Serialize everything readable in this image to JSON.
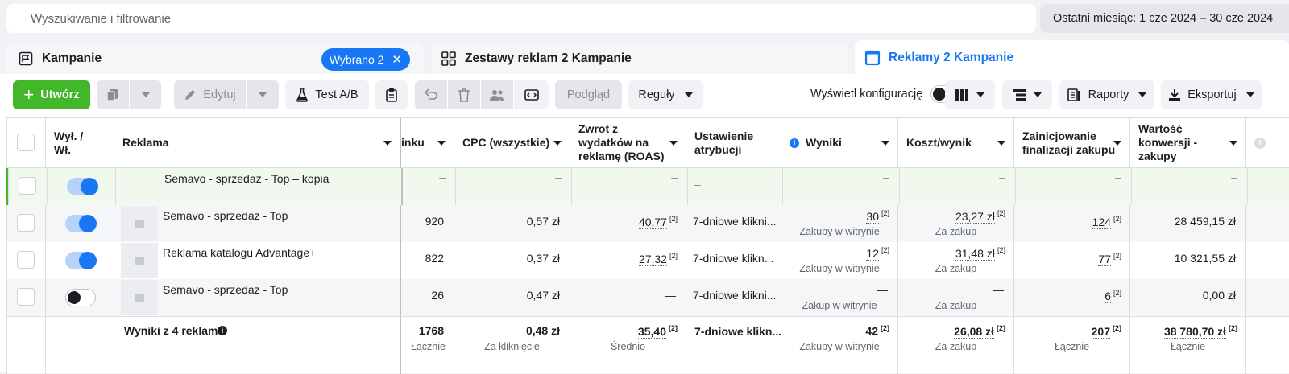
{
  "search": {
    "placeholder": "Wyszukiwanie i filtrowanie"
  },
  "date_range": "Ostatni miesiąc: 1 cze 2024 – 30 cze 2024",
  "tabs": {
    "campaigns": "Kampanie",
    "selected_badge": "Wybrano 2",
    "adsets": "Zestawy reklam 2 Kampanie",
    "ads": "Reklamy 2 Kampanie"
  },
  "toolbar": {
    "create": "Utwórz",
    "edit": "Edytuj",
    "abtest": "Test A/B",
    "preview": "Podgląd",
    "rules": "Reguły",
    "show_config": "Wyświetl konfigurację",
    "reports": "Raporty",
    "export": "Eksportuj"
  },
  "headers": {
    "onoff": "Wył. / Wł.",
    "ad": "Reklama",
    "clicks_partial": "inku",
    "cpc": "CPC (wszystkie)",
    "roas": "Zwrot z wydatków na reklamę (ROAS)",
    "attribution": "Ustawienie atrybucji",
    "results": "Wyniki",
    "cost": "Koszt/wynik",
    "checkout": "Zainicjowanie finalizacji zakupu",
    "value": "Wartość konwersji - zakupy"
  },
  "rows": [
    {
      "on": true,
      "name": "Semavo - sprzedaż - Top – kopia",
      "clicks": "–",
      "cpc": "–",
      "roas": "–",
      "attr": "–",
      "results": "–",
      "results_sub": "",
      "cost": "–",
      "cost_sub": "",
      "checkout": "–",
      "value": "–"
    },
    {
      "on": true,
      "name": "Semavo - sprzedaż - Top",
      "clicks": "920",
      "cpc": "0,57 zł",
      "roas": "40,77",
      "attr": "7-dniowe klikni...",
      "results": "30",
      "results_sub": "Zakupy w witrynie",
      "cost": "23,27 zł",
      "cost_sub": "Za zakup",
      "checkout": "124",
      "value": "28 459,15 zł"
    },
    {
      "on": true,
      "name": "Reklama katalogu Advantage+",
      "clicks": "822",
      "cpc": "0,37 zł",
      "roas": "27,32",
      "attr": "7-dniowe klikn...",
      "results": "12",
      "results_sub": "Zakupy w witrynie",
      "cost": "31,48 zł",
      "cost_sub": "Za zakup",
      "checkout": "77",
      "value": "10 321,55 zł"
    },
    {
      "on": false,
      "name": "Semavo - sprzedaż - Top",
      "clicks": "26",
      "cpc": "0,47 zł",
      "roas": "—",
      "attr": "7-dniowe klikni...",
      "results": "—",
      "results_sub": "Zakup w witrynie",
      "cost": "—",
      "cost_sub": "Za zakup",
      "checkout": "6",
      "value": "0,00 zł"
    }
  ],
  "sup_mark": "[2]",
  "totals": {
    "label": "Wyniki z 4 reklam",
    "clicks": "1768",
    "clicks_sub": "Łącznie",
    "cpc": "0,48 zł",
    "cpc_sub": "Za kliknięcie",
    "roas": "35,40",
    "roas_sub": "Średnio",
    "attr": "7-dniowe klikn...",
    "results": "42",
    "results_sub": "Zakupy w witrynie",
    "cost": "26,08 zł",
    "cost_sub": "Za zakup",
    "checkout": "207",
    "checkout_sub": "Łącznie",
    "value": "38 780,70 zł",
    "value_sub": "Łącznie"
  },
  "colors": {
    "accent": "#1877f2",
    "green": "#42b72a",
    "highlight_row": "#f1f8ee",
    "alt_row": "#f5f6f7"
  }
}
